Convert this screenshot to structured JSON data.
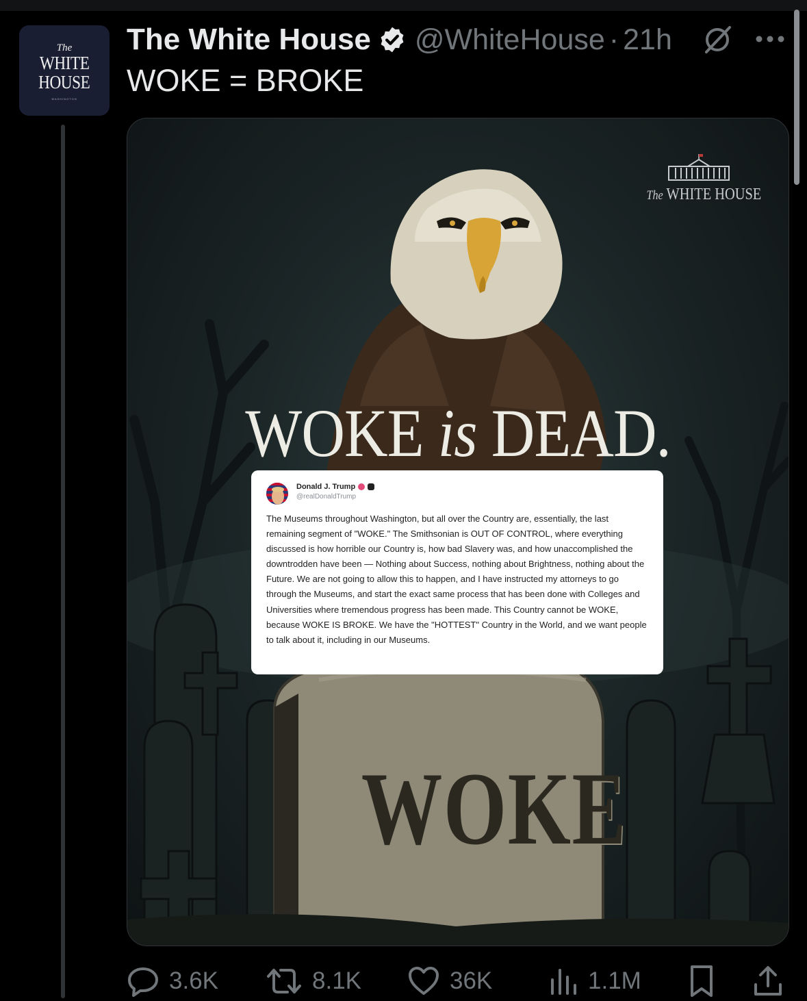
{
  "account": {
    "avatar": {
      "line1": "The",
      "line2": "WHITE",
      "line3": "HOUSE",
      "line4": "WASHINGTON"
    },
    "name": "The White House",
    "handle": "@WhiteHouse",
    "separator": "·",
    "time": "21h",
    "verified": true
  },
  "tweet": {
    "text": "WOKE = BROKE"
  },
  "media": {
    "logo_the": "The",
    "logo_text": "WHITE HOUSE",
    "headline_part1": "WOKE",
    "headline_is": "is",
    "headline_part2": "DEAD.",
    "tombstone_text": "WOKE",
    "embedded_post": {
      "name": "Donald J. Trump",
      "handle": "@realDonaldTrump",
      "body": "The Museums throughout Washington, but all over the Country are, essentially, the last remaining segment of \"WOKE.\" The Smithsonian is OUT OF CONTROL, where everything discussed is how horrible our Country is, how bad Slavery was, and how unaccomplished the downtrodden have been — Nothing about Success, nothing about Brightness, nothing about the Future. We are not going to allow this to happen, and I have instructed my attorneys to go through the Museums, and start the exact same process that has been done with Colleges and Universities where tremendous progress has been made. This Country cannot be WOKE, because WOKE IS BROKE. We have the \"HOTTEST\" Country in the World, and we want people to talk about it, including in our Museums."
    }
  },
  "actions": {
    "replies": "3.6K",
    "reposts": "8.1K",
    "likes": "36K",
    "views": "1.1M"
  },
  "colors": {
    "background": "#000000",
    "text": "#e7e9ea",
    "muted": "#71767b",
    "verified": "#e7e9ea"
  },
  "icons": [
    "verified-badge-icon",
    "grok-icon",
    "more-icon",
    "reply-icon",
    "repost-icon",
    "like-icon",
    "views-icon",
    "bookmark-icon",
    "share-icon"
  ]
}
